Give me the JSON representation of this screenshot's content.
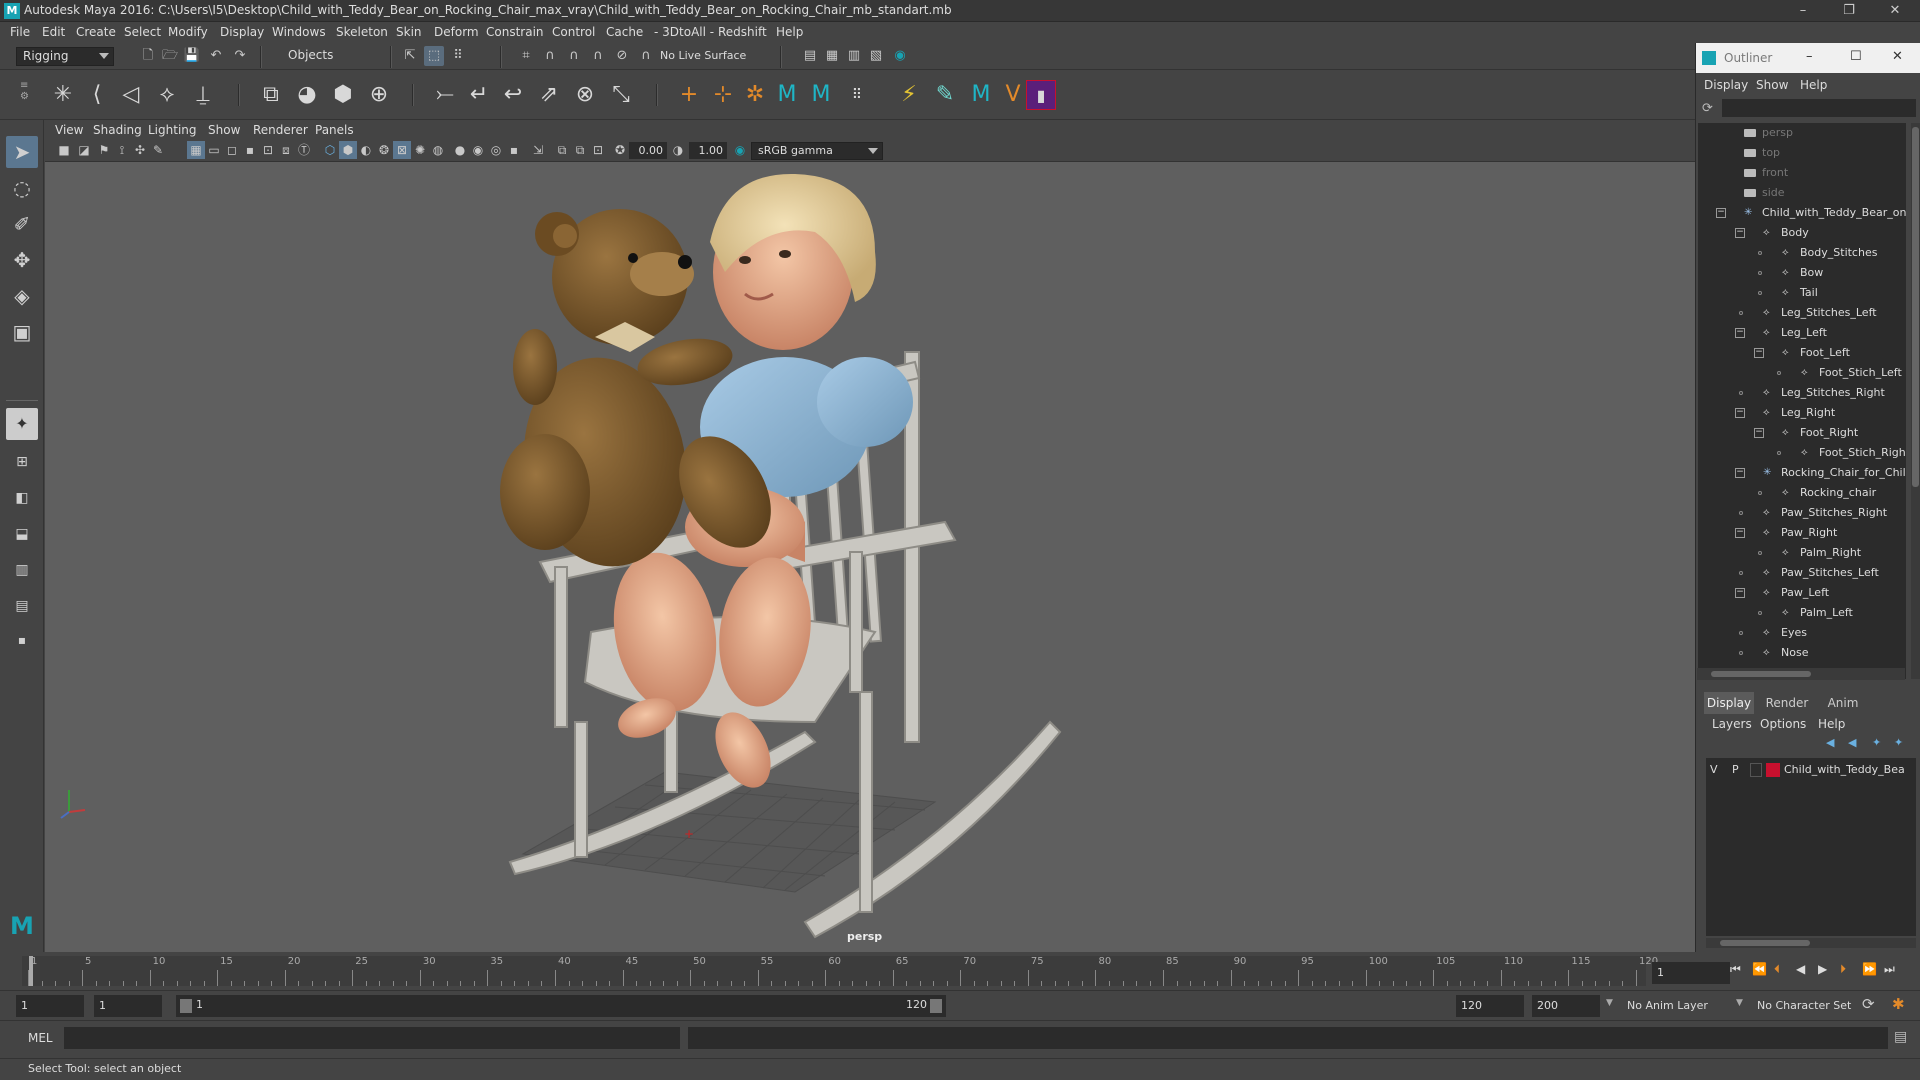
{
  "window": {
    "title": "Autodesk Maya 2016: C:\\Users\\I5\\Desktop\\Child_with_Teddy_Bear_on_Rocking_Chair_max_vray\\Child_with_Teddy_Bear_on_Rocking_Chair_mb_standart.mb",
    "logo": "M"
  },
  "menubar": [
    "File",
    "Edit",
    "Create",
    "Select",
    "Modify",
    "Display",
    "Windows",
    "Skeleton",
    "Skin",
    "Deform",
    "Constrain",
    "Control",
    "Cache",
    "- 3DtoAll -",
    "Redshift",
    "Help"
  ],
  "statusline": {
    "mode": "Rigging",
    "selection_mask": "Objects",
    "live_surface": "No Live Surface"
  },
  "viewport": {
    "menu": [
      "View",
      "Shading",
      "Lighting",
      "Show",
      "Renderer",
      "Panels"
    ],
    "near": "0.00",
    "far": "1.00",
    "color_space": "sRGB gamma",
    "camera_label": "persp"
  },
  "outliner": {
    "title": "Outliner",
    "menu": [
      "Display",
      "Show",
      "Help"
    ],
    "items": [
      {
        "label": "persp",
        "level": 0,
        "kind": "camera",
        "dim": true
      },
      {
        "label": "top",
        "level": 0,
        "kind": "camera",
        "dim": true
      },
      {
        "label": "front",
        "level": 0,
        "kind": "camera",
        "dim": true
      },
      {
        "label": "side",
        "level": 0,
        "kind": "camera",
        "dim": true
      },
      {
        "label": "Child_with_Teddy_Bear_on_F",
        "level": 0,
        "kind": "group",
        "toggle": "−"
      },
      {
        "label": "Body",
        "level": 1,
        "kind": "mesh",
        "toggle": "−"
      },
      {
        "label": "Body_Stitches",
        "level": 2,
        "kind": "mesh"
      },
      {
        "label": "Bow",
        "level": 2,
        "kind": "mesh"
      },
      {
        "label": "Tail",
        "level": 2,
        "kind": "mesh"
      },
      {
        "label": "Leg_Stitches_Left",
        "level": 1,
        "kind": "mesh"
      },
      {
        "label": "Leg_Left",
        "level": 1,
        "kind": "mesh",
        "toggle": "−"
      },
      {
        "label": "Foot_Left",
        "level": 2,
        "kind": "mesh",
        "toggle": "−"
      },
      {
        "label": "Foot_Stich_Left",
        "level": 3,
        "kind": "mesh"
      },
      {
        "label": "Leg_Stitches_Right",
        "level": 1,
        "kind": "mesh"
      },
      {
        "label": "Leg_Right",
        "level": 1,
        "kind": "mesh",
        "toggle": "−"
      },
      {
        "label": "Foot_Right",
        "level": 2,
        "kind": "mesh",
        "toggle": "−"
      },
      {
        "label": "Foot_Stich_Right",
        "level": 3,
        "kind": "mesh"
      },
      {
        "label": "Rocking_Chair_for_Child",
        "level": 1,
        "kind": "group",
        "toggle": "−"
      },
      {
        "label": "Rocking_chair",
        "level": 2,
        "kind": "mesh"
      },
      {
        "label": "Paw_Stitches_Right",
        "level": 1,
        "kind": "mesh"
      },
      {
        "label": "Paw_Right",
        "level": 1,
        "kind": "mesh",
        "toggle": "−"
      },
      {
        "label": "Palm_Right",
        "level": 2,
        "kind": "mesh"
      },
      {
        "label": "Paw_Stitches_Left",
        "level": 1,
        "kind": "mesh"
      },
      {
        "label": "Paw_Left",
        "level": 1,
        "kind": "mesh",
        "toggle": "−"
      },
      {
        "label": "Palm_Left",
        "level": 2,
        "kind": "mesh"
      },
      {
        "label": "Eyes",
        "level": 1,
        "kind": "mesh"
      },
      {
        "label": "Nose",
        "level": 1,
        "kind": "mesh"
      }
    ]
  },
  "layers": {
    "tabs": [
      "Display",
      "Render",
      "Anim"
    ],
    "menu": [
      "Layers",
      "Options",
      "Help"
    ],
    "layer": {
      "v": "V",
      "p": "P",
      "name": "Child_with_Teddy_Bea",
      "color": "#c8102e"
    }
  },
  "timeline": {
    "ticks": [
      "1",
      "5",
      "10",
      "15",
      "20",
      "25",
      "30",
      "35",
      "40",
      "45",
      "50",
      "55",
      "60",
      "65",
      "70",
      "75",
      "80",
      "85",
      "90",
      "95",
      "100",
      "105",
      "110",
      "115",
      "120"
    ],
    "current_frame": "1"
  },
  "range": {
    "start": "1",
    "start_inner": "1",
    "slider_start": "1",
    "slider_end": "120",
    "end_inner": "120",
    "end": "200",
    "anim_layer": "No Anim Layer",
    "character_set": "No Character Set"
  },
  "commandline": {
    "lang": "MEL"
  },
  "helpline": {
    "text": "Select Tool: select an object"
  },
  "colors": {
    "accent": "#18a3b3",
    "layer": "#c8102e"
  }
}
